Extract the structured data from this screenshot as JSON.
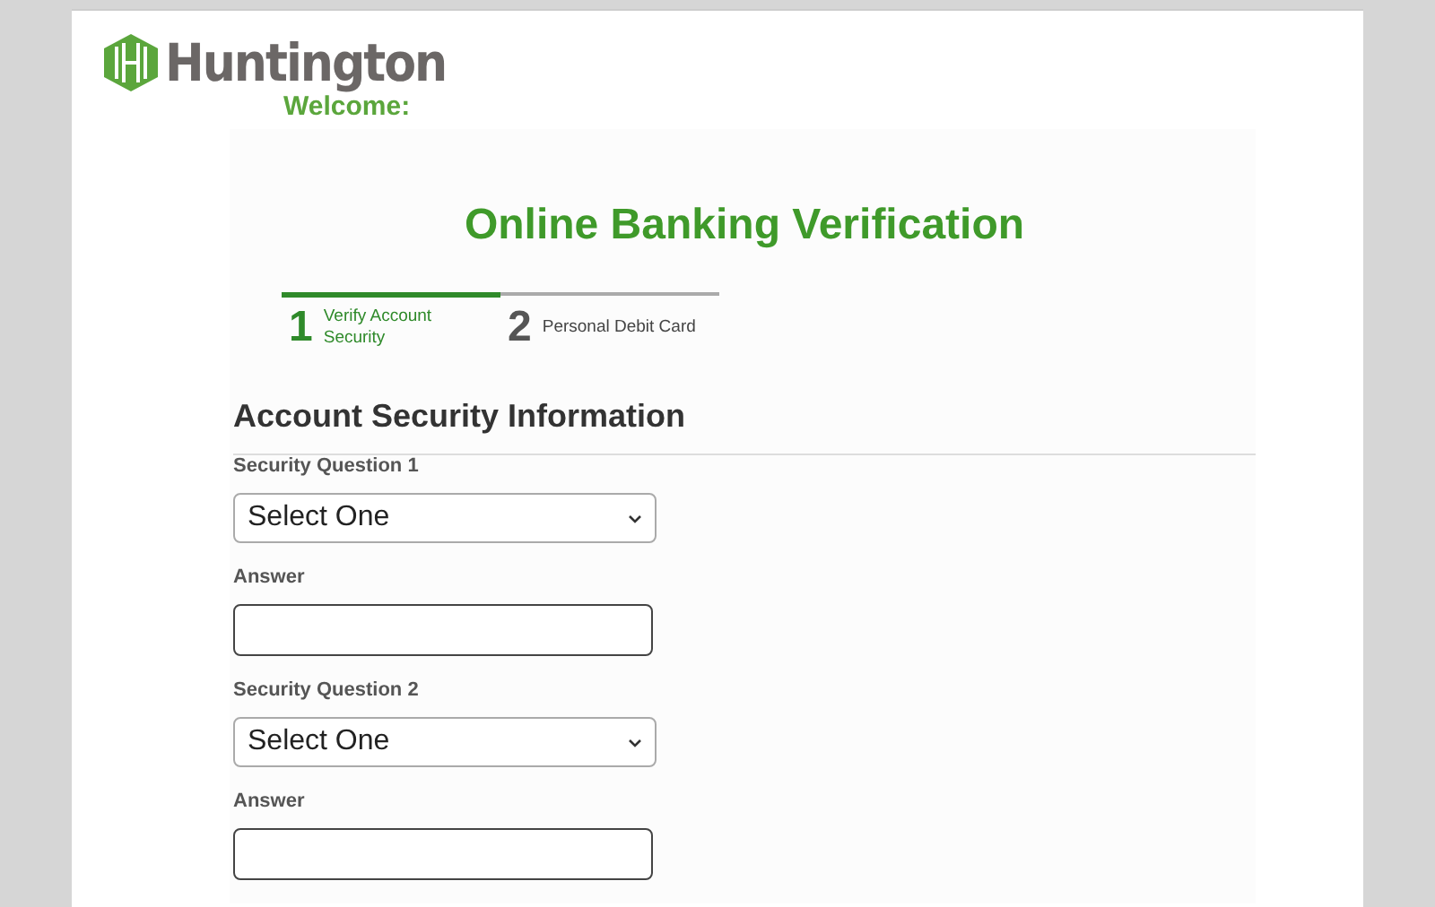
{
  "brand": {
    "name": "Huntington",
    "welcome": "Welcome:"
  },
  "title": "Online Banking Verification",
  "steps": [
    {
      "number": "1",
      "label": "Verify Account Security",
      "selected": true
    },
    {
      "number": "2",
      "label": "Personal Debit Card",
      "selected": false
    }
  ],
  "section_heading": "Account Security Information",
  "fields": [
    {
      "kind": "select",
      "label": "Security Question 1",
      "value": "Select One"
    },
    {
      "kind": "text",
      "label": "Answer"
    },
    {
      "kind": "select",
      "label": "Security Question 2",
      "value": "Select One"
    },
    {
      "kind": "text",
      "label": "Answer"
    }
  ]
}
